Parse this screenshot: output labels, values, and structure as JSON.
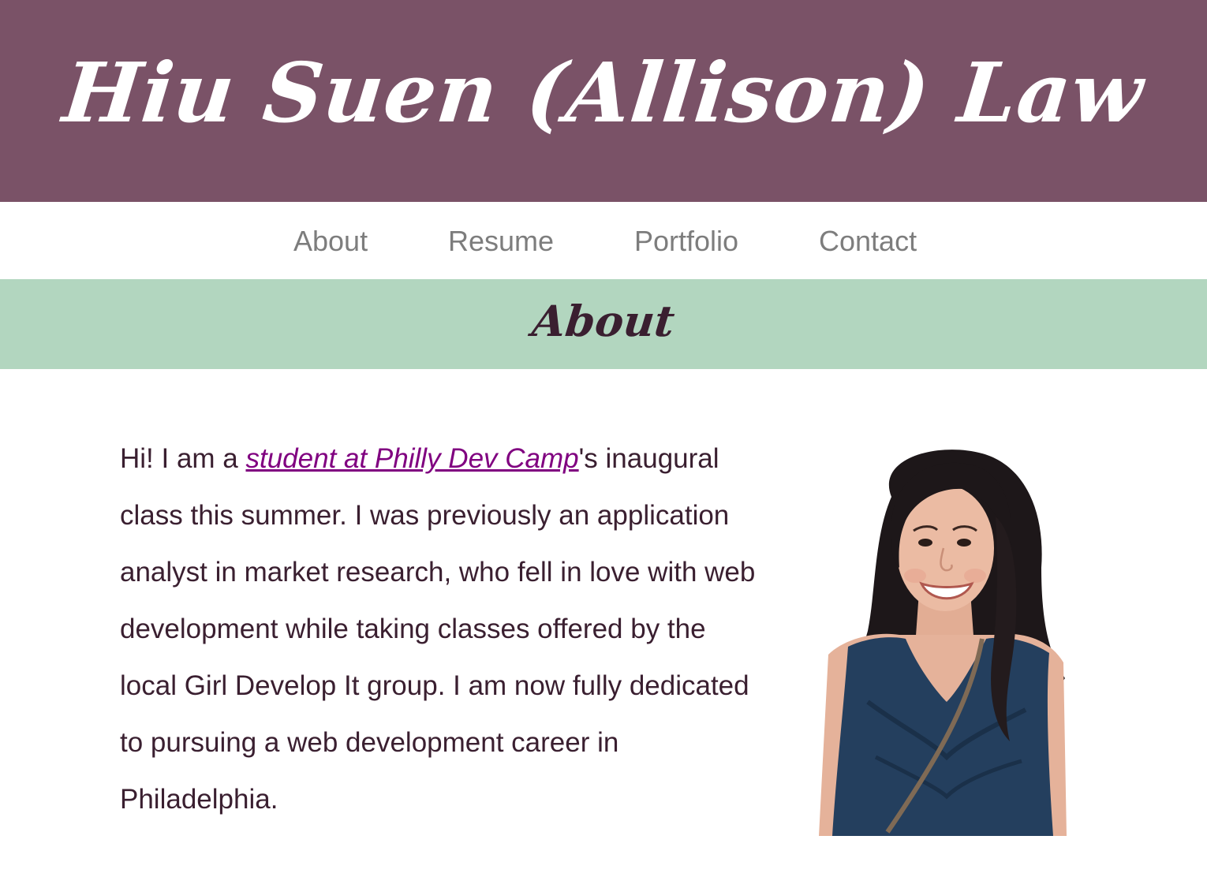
{
  "header": {
    "title": "Hiu Suen (Allison) Law",
    "background_color": "#7a5267"
  },
  "nav": {
    "items": [
      {
        "label": "About"
      },
      {
        "label": "Resume"
      },
      {
        "label": "Portfolio"
      },
      {
        "label": "Contact"
      }
    ],
    "text_color": "#7d7d7d"
  },
  "section": {
    "title": "About",
    "background_color": "#b2d6bf"
  },
  "about": {
    "text_before_link": "Hi! I am a ",
    "link_text": "student at Philly Dev Camp",
    "text_after_link": "'s inaugural class this summer. I was previously an application analyst in market research, who fell in love with web development while taking classes offered by the local Girl Develop It group. I am now fully dedicated to pursuing a web development career in Philadelphia.",
    "link_color": "#800080",
    "text_color": "#3a1f30"
  },
  "photo": {
    "icon": "portrait-photo"
  }
}
